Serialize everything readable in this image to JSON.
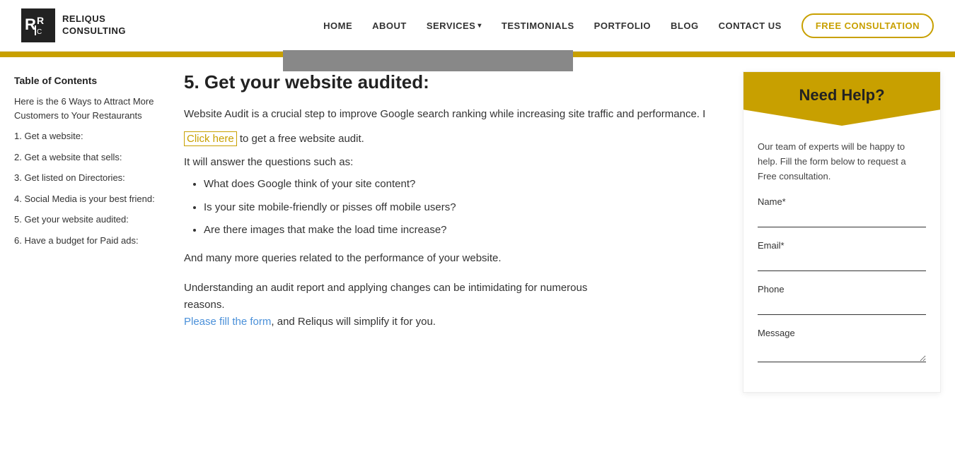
{
  "header": {
    "logo_line1": "RELIQUS",
    "logo_line2": "CONSULTING",
    "nav": {
      "home": "HOME",
      "about": "ABOUT",
      "services": "SERVICES",
      "services_chevron": "▾",
      "testimonials": "TESTIMONIALS",
      "portfolio": "PORTFOLIO",
      "blog": "BLOG",
      "contact_us": "CONTACT US",
      "free_consultation": "FREE CONSULTATION"
    }
  },
  "sidebar": {
    "toc_title": "Table of Contents",
    "links": [
      "Here is the 6 Ways to Attract More Customers to Your Restaurants",
      "1. Get a website:",
      "2. Get a website that sells:",
      "3. Get listed on Directories:",
      "4. Social Media is your best friend:",
      "5. Get your website audited:",
      "6. Have a budget for Paid ads:"
    ]
  },
  "content": {
    "section_title": "5. Get your website audited:",
    "intro": "Website Audit is a crucial step to improve Google search ranking while increasing site traffic and performance. I",
    "click_here_text": "Click here",
    "click_here_suffix": " to get a free website audit.",
    "questions_intro": "It will answer the questions such as:",
    "bullet_items": [
      "What does Google think of your site content?",
      "Is your site mobile-friendly or pisses off mobile users?",
      "Are there images that make the load time increase?"
    ],
    "more_queries": "And many more queries related to the performance of your website.",
    "understanding_line1": "Understanding an audit report and applying changes can be intimidating for numerous",
    "understanding_line2": "reasons.",
    "please_text": "Please fill the form",
    "please_suffix": ", and Reliqus will simplify it for you."
  },
  "form_sidebar": {
    "need_help_title": "Need Help?",
    "help_desc": "Our team of experts will be happy to help. Fill the form below to request a Free consultation.",
    "fields": [
      {
        "label": "Name*",
        "type": "text",
        "name": "name-input"
      },
      {
        "label": "Email*",
        "type": "email",
        "name": "email-input"
      },
      {
        "label": "Phone",
        "type": "tel",
        "name": "phone-input"
      },
      {
        "label": "Message",
        "type": "textarea",
        "name": "message-input"
      }
    ]
  }
}
